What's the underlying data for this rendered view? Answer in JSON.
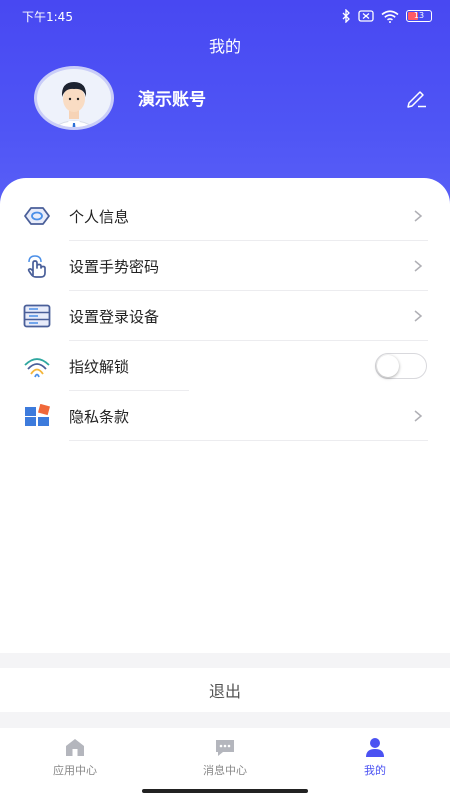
{
  "status_bar": {
    "time": "下午1:45",
    "battery": "13"
  },
  "header": {
    "title": "我的",
    "account_name": "演示账号"
  },
  "menu": {
    "items": [
      {
        "label": "个人信息",
        "icon": "eye-icon"
      },
      {
        "label": "设置手势密码",
        "icon": "gesture-hand-icon"
      },
      {
        "label": "设置登录设备",
        "icon": "server-list-icon"
      },
      {
        "label": "指纹解锁",
        "icon": "fingerprint-icon",
        "toggle": false
      },
      {
        "label": "隐私条款",
        "icon": "blocks-icon"
      }
    ]
  },
  "logout_label": "退出",
  "tabbar": {
    "tabs": [
      {
        "label": "应用中心",
        "icon": "home-icon"
      },
      {
        "label": "消息中心",
        "icon": "chat-icon"
      },
      {
        "label": "我的",
        "icon": "user-icon",
        "active": true
      }
    ]
  },
  "colors": {
    "accent": "#4b52f2",
    "header_bg": "#4848f2",
    "battery_low": "#ff5a66"
  }
}
